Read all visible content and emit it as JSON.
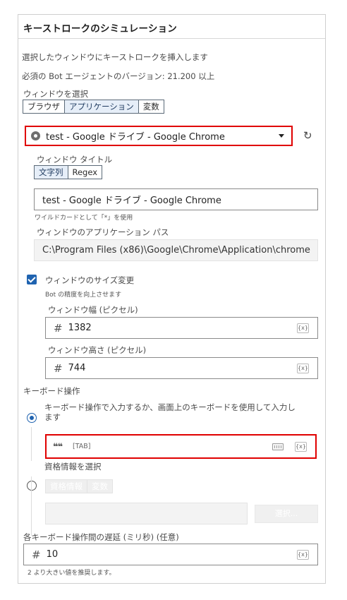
{
  "title": "キーストロークのシミュレーション",
  "description": "選択したウィンドウにキーストロークを挿入します",
  "bot_version": "必須の Bot エージェントのバージョン: 21.200 以上",
  "window_select": {
    "label": "ウィンドウを選択",
    "tabs": [
      "ブラウザ",
      "アプリケーション",
      "変数"
    ],
    "active_tab": "アプリケーション",
    "dropdown_value": "test - Google ドライブ - Google Chrome"
  },
  "window_title": {
    "label": "ウィンドウ タイトル",
    "tabs": [
      "文字列",
      "Regex"
    ],
    "active_tab": "文字列",
    "value": "test - Google ドライブ - Google Chrome",
    "hint": "ワイルドカードとして「*」を使用"
  },
  "app_path": {
    "label": "ウィンドウのアプリケーション パス",
    "value": "C:\\Program Files (x86)\\Google\\Chrome\\Application\\chrome"
  },
  "resize": {
    "label": "ウィンドウのサイズ変更",
    "checked": true,
    "hint": "Bot の精度を向上させます",
    "width_label": "ウィンドウ幅 (ピクセル)",
    "width_value": "1382",
    "height_label": "ウィンドウ高さ (ピクセル)",
    "height_value": "744"
  },
  "keyboard": {
    "section_label": "キーボード操作",
    "option1_line1": "キーボード操作で入力するか、画面上のキーボードを使用して入力し",
    "option1_line2": "ます",
    "value": "[TAB]",
    "option2_label": "資格情報を選択",
    "cred_tabs": [
      "資格情報",
      "変数"
    ],
    "select_button": "選択..."
  },
  "delay": {
    "label": "各キーボード操作間の遅延 (ミリ秒) (任意)",
    "value": "10",
    "hint": "2 より大きい値を推奨します。"
  },
  "badge": "{x}",
  "colors": {
    "accent": "#1f63b0",
    "highlight": "#e00000"
  }
}
